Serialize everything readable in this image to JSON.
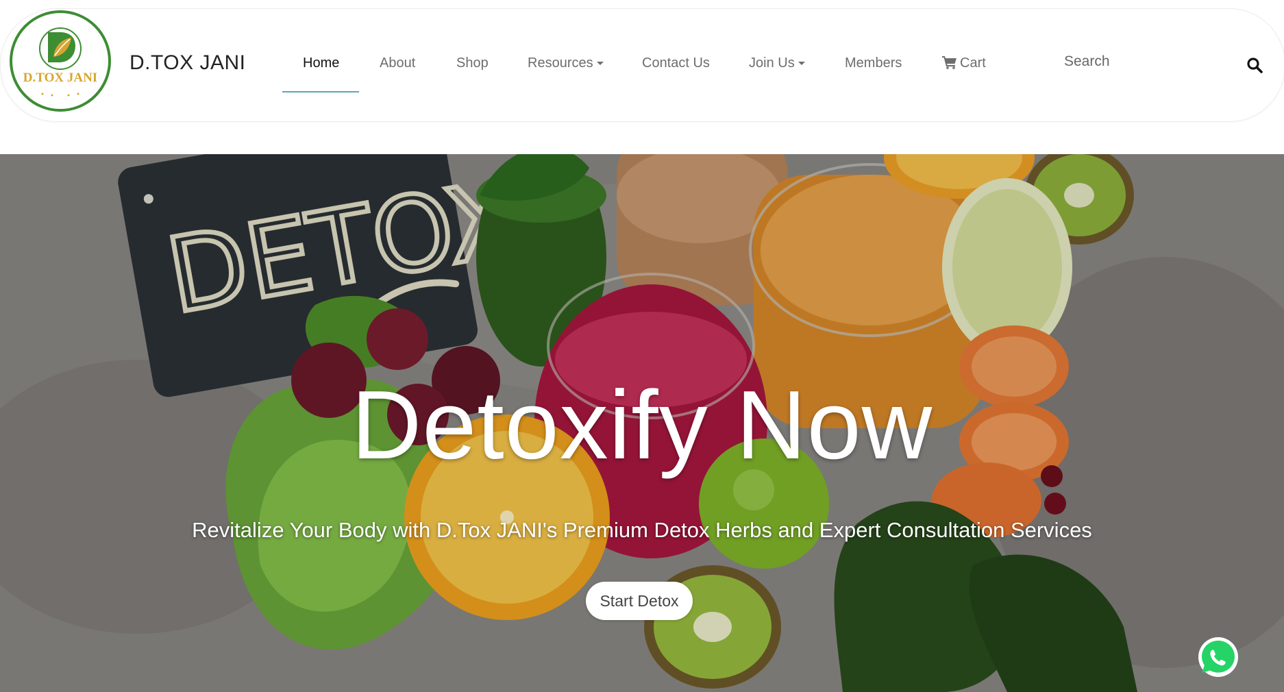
{
  "header": {
    "logo_text": "D.TOX JANI",
    "brand_name": "D.TOX JANI",
    "nav": {
      "home": "Home",
      "about": "About",
      "shop": "Shop",
      "resources": "Resources",
      "contact": "Contact Us",
      "join": "Join Us",
      "members": "Members",
      "cart": "Cart"
    },
    "search_placeholder": "Search"
  },
  "hero": {
    "chalkboard_text": "DETOX",
    "title": "Detoxify Now",
    "subtitle": "Revitalize Your Body with D.Tox JANI's Premium Detox Herbs and Expert Consultation Services",
    "cta_label": "Start Detox"
  },
  "icons": {
    "search": "search-icon",
    "cart": "cart-icon",
    "whatsapp": "whatsapp-icon",
    "dropdown": "caret-down-icon"
  },
  "colors": {
    "logo_green": "#3d8d33",
    "logo_gold": "#d7a531",
    "active_underline": "#5aa7b8",
    "whatsapp_green": "#25d366"
  }
}
